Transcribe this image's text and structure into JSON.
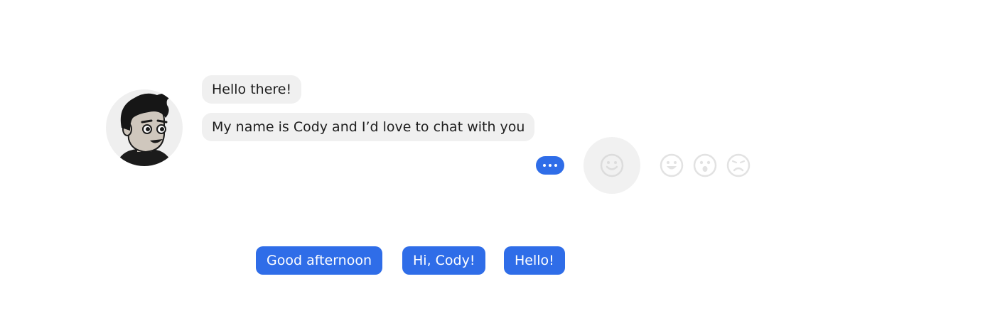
{
  "chat": {
    "bot_avatar_icon": "cartoon-man-avatar",
    "messages": [
      {
        "text": "Hello there!"
      },
      {
        "text": "My name is Cody and I’d love to chat with you"
      }
    ],
    "more_icon": "ellipsis-icon"
  },
  "reactions": {
    "selected_icon": "smile-icon",
    "options": [
      "grin-icon",
      "surprised-icon",
      "sad-icon"
    ]
  },
  "quick_replies": [
    {
      "label": "Good afternoon"
    },
    {
      "label": "Hi, Cody!"
    },
    {
      "label": "Hello!"
    }
  ],
  "colors": {
    "accent": "#2f6de8",
    "bubble": "#f0f0f0",
    "reaction_stroke": "#e2e2e2"
  }
}
